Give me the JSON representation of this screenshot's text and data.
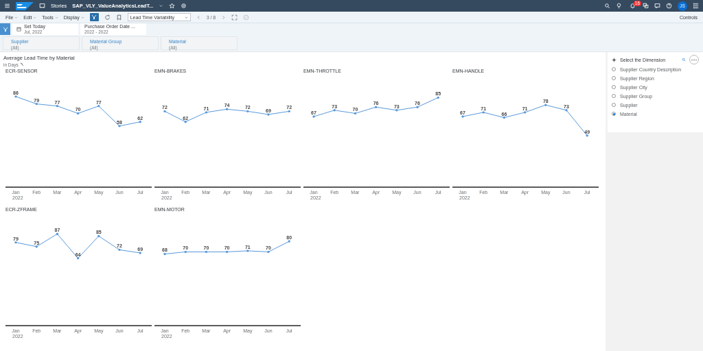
{
  "shell_bar": {
    "app": "Stories",
    "story_title": "SAP_VLY_ValueAnalyticsLeadT...",
    "notification_count": "16",
    "avatar": "JS"
  },
  "toolbar": {
    "menus": [
      "File",
      "Edit",
      "Tools",
      "Display"
    ],
    "filter_active": true,
    "variant": "Lead Time Variability",
    "page": "3 / 8",
    "controls": "Controls"
  },
  "filters": [
    {
      "kind": "date",
      "label": "Set Today",
      "value": "Jul, 2022"
    },
    {
      "kind": "range",
      "label": "Purchase Order Date ...",
      "value": "2022 - 2022"
    }
  ],
  "input_controls": [
    {
      "label": "Supplier",
      "value": "(All)"
    },
    {
      "label": "Material Group",
      "value": "(All)"
    },
    {
      "label": "Material",
      "value": "(All)"
    }
  ],
  "widget": {
    "title": "Average Lead Time by Material",
    "unit": "in Days",
    "charts": [
      {
        "chart_data": {
          "type": "line",
          "title": "ECR-SENSOR",
          "xlabel": "2022",
          "categories": [
            "Jan",
            "Feb",
            "Mar",
            "Apr",
            "May",
            "Jun",
            "Jul"
          ],
          "series": [
            {
              "color": "#5899da",
              "values": [
                86,
                79,
                77,
                70,
                77,
                58,
                62
              ]
            }
          ],
          "data_labels": true
        }
      },
      {
        "chart_data": {
          "type": "line",
          "title": "EMN-BRAKES",
          "xlabel": "2022",
          "categories": [
            "Jan",
            "Feb",
            "Mar",
            "Apr",
            "May",
            "Jun",
            "Jul"
          ],
          "series": [
            {
              "color": "#5899da",
              "values": [
                72,
                62,
                71,
                74,
                72,
                69,
                72
              ]
            }
          ],
          "data_labels": true
        }
      },
      {
        "chart_data": {
          "type": "line",
          "title": "EMN-THROTTLE",
          "xlabel": "2022",
          "categories": [
            "Jan",
            "Feb",
            "Mar",
            "Apr",
            "May",
            "Jun",
            "Jul"
          ],
          "series": [
            {
              "color": "#5899da",
              "values": [
                67,
                73,
                70,
                76,
                73,
                76,
                85
              ]
            }
          ],
          "data_labels": true
        }
      },
      {
        "chart_data": {
          "type": "line",
          "title": "EMN-HANDLE",
          "xlabel": "2022",
          "categories": [
            "Jan",
            "Feb",
            "Mar",
            "Apr",
            "May",
            "Jun",
            "Jul"
          ],
          "series": [
            {
              "color": "#5899da",
              "values": [
                67,
                71,
                66,
                71,
                78,
                73,
                49
              ]
            }
          ],
          "data_labels": true
        }
      },
      {
        "chart_data": {
          "type": "line",
          "title": "ECR-ZFRAME",
          "xlabel": "2022",
          "categories": [
            "Jan",
            "Feb",
            "Mar",
            "Apr",
            "May",
            "Jun",
            "Jul"
          ],
          "series": [
            {
              "color": "#5899da",
              "values": [
                79,
                75,
                87,
                64,
                85,
                72,
                69
              ]
            }
          ],
          "data_labels": true
        }
      },
      {
        "chart_data": {
          "type": "line",
          "title": "EMN-MOTOR",
          "xlabel": "2022",
          "categories": [
            "Jan",
            "Feb",
            "Mar",
            "Apr",
            "May",
            "Jun",
            "Jul"
          ],
          "series": [
            {
              "color": "#5899da",
              "values": [
                68,
                70,
                70,
                70,
                71,
                70,
                80
              ]
            }
          ],
          "data_labels": true
        }
      }
    ]
  },
  "dimensions": {
    "title": "Select the Dimension",
    "items": [
      {
        "label": "Supplier Country Description",
        "selected": false
      },
      {
        "label": "Supplier Region",
        "selected": false
      },
      {
        "label": "Supplier City",
        "selected": false
      },
      {
        "label": "Supplier Group",
        "selected": false
      },
      {
        "label": "Supplier",
        "selected": false
      },
      {
        "label": "Material",
        "selected": true
      }
    ]
  }
}
